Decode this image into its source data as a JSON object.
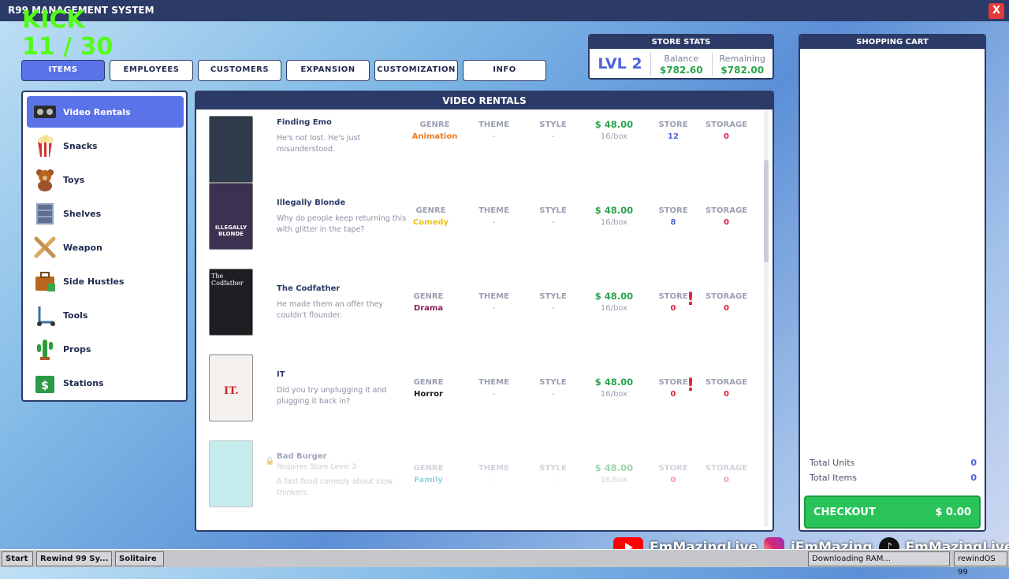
{
  "window": {
    "title": "R99 MANAGEMENT SYSTEM",
    "close_label": "X"
  },
  "overlay": {
    "brand": "KICK",
    "counter": "11 / 30"
  },
  "tabs": [
    {
      "label": "ITEMS",
      "active": true
    },
    {
      "label": "EMPLOYEES"
    },
    {
      "label": "CUSTOMERS"
    },
    {
      "label": "EXPANSION"
    },
    {
      "label": "CUSTOMIZATION"
    },
    {
      "label": "INFO"
    }
  ],
  "store_stats": {
    "title": "STORE STATS",
    "level": "LVL 2",
    "balance_label": "Balance",
    "balance": "$782.60",
    "remaining_label": "Remaining",
    "remaining": "$782.00"
  },
  "cart": {
    "title": "SHOPPING CART",
    "total_units_label": "Total Units",
    "total_units": "0",
    "total_items_label": "Total Items",
    "total_items": "0",
    "checkout_label": "CHECKOUT",
    "checkout_total": "$ 0.00"
  },
  "categories": [
    {
      "label": "Video Rentals",
      "icon": "vhs-tape-icon",
      "active": true
    },
    {
      "label": "Snacks",
      "icon": "popcorn-icon"
    },
    {
      "label": "Toys",
      "icon": "teddy-bear-icon"
    },
    {
      "label": "Shelves",
      "icon": "shelf-icon"
    },
    {
      "label": "Weapon",
      "icon": "crossed-bats-icon"
    },
    {
      "label": "Side Hustles",
      "icon": "briefcase-icon"
    },
    {
      "label": "Tools",
      "icon": "scooter-icon"
    },
    {
      "label": "Props",
      "icon": "cactus-icon"
    },
    {
      "label": "Stations",
      "icon": "register-icon"
    }
  ],
  "main": {
    "title": "VIDEO RENTALS",
    "headers": {
      "genre": "GENRE",
      "theme": "THEME",
      "style": "STYLE",
      "store": "STORE",
      "storage": "STORAGE"
    },
    "items": [
      {
        "title": "Finding Emo",
        "desc": "He's not lost. He's just misunderstood.",
        "genre": "Animation",
        "genre_color": "#f07a1a",
        "theme": "-",
        "style": "-",
        "price": "$ 48.00",
        "per_box": "16/box",
        "store": "12",
        "storage": "0",
        "cover_color": "#2f3a4a"
      },
      {
        "title": "Illegally Blonde",
        "desc": "Why do people keep returning this with glitter in the tape?",
        "genre": "Comedy",
        "genre_color": "#e8c21c",
        "theme": "-",
        "style": "-",
        "price": "$ 48.00",
        "per_box": "16/box",
        "store": "8",
        "storage": "0",
        "cover_color": "#3b3150",
        "cover_text": "ILLEGALLY BLONDE"
      },
      {
        "title": "The Codfather",
        "desc": "He made them an offer they couldn't flounder.",
        "genre": "Drama",
        "genre_color": "#8a1f5a",
        "theme": "-",
        "style": "-",
        "price": "$ 48.00",
        "per_box": "16/box",
        "store": "0",
        "storage": "0",
        "cover_color": "#1d1d22",
        "cover_text": "The Codfather",
        "warn": "!"
      },
      {
        "title": "IT",
        "desc": "Did you try unplugging it and plugging it back in?",
        "genre": "Horror",
        "genre_color": "#1a1a1a",
        "theme": "-",
        "style": "-",
        "price": "$ 48.00",
        "per_box": "16/box",
        "store": "0",
        "storage": "0",
        "cover_color": "#f4f1ee",
        "cover_text": "IT.",
        "warn": "!"
      },
      {
        "title": "Bad Burger",
        "requirement": "Requires Store Level 3",
        "desc": "A fast-food comedy about slow thinkers.",
        "genre": "Family",
        "genre_color": "#1aa0b8",
        "theme": "-",
        "style": "-",
        "price": "$ 48.00",
        "per_box": "16/box",
        "store": "0",
        "storage": "0",
        "cover_color": "#7fd4d9",
        "locked": true
      }
    ]
  },
  "taskbar": {
    "start": "Start",
    "app": "Rewind 99 Sy...",
    "game": "Solitaire",
    "status": "Downloading RAM...",
    "os": "rewindOS 99"
  },
  "social": {
    "youtube": "EmMazingLive",
    "instagram": "iEmMazing",
    "tiktok": "EmMazingLive"
  }
}
